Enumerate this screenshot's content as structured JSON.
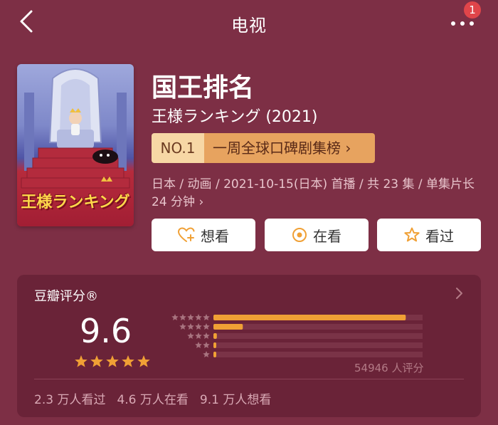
{
  "header": {
    "title": "电视",
    "back_icon": "chevron-left-icon",
    "more_icon": "more-dots-icon",
    "badge_count": "1"
  },
  "show": {
    "title": "国王排名",
    "original_title": "王様ランキング (2021)",
    "poster_title": "王様ランキング",
    "rank_no": "NO.1",
    "rank_text": "一周全球口碑剧集榜 ›",
    "meta": "日本 / 动画 / 2021-10-15(日本) 首播 / 共 23 集 / 单集片长 24 分钟 ›"
  },
  "actions": [
    {
      "label": "想看",
      "icon": "heart-plus-icon"
    },
    {
      "label": "在看",
      "icon": "target-icon"
    },
    {
      "label": "看过",
      "icon": "star-outline-icon"
    }
  ],
  "rating": {
    "title": "豆瓣评分®",
    "score": "9.6",
    "star_count": 5,
    "distribution": [
      0.85,
      0.13,
      0.015,
      0.005,
      0.0
    ],
    "count_text": "54946 人评分",
    "watched": "2.3 万人看过",
    "watching": "4.6 万人在看",
    "want": "9.1 万人想看"
  },
  "colors": {
    "background": "#7d2f45",
    "card": "#6a2338",
    "bar": "#f0a035",
    "rank_no_bg": "#f7d7a5",
    "rank_bg": "#e7a35f",
    "accent_orange": "#f0a035"
  }
}
